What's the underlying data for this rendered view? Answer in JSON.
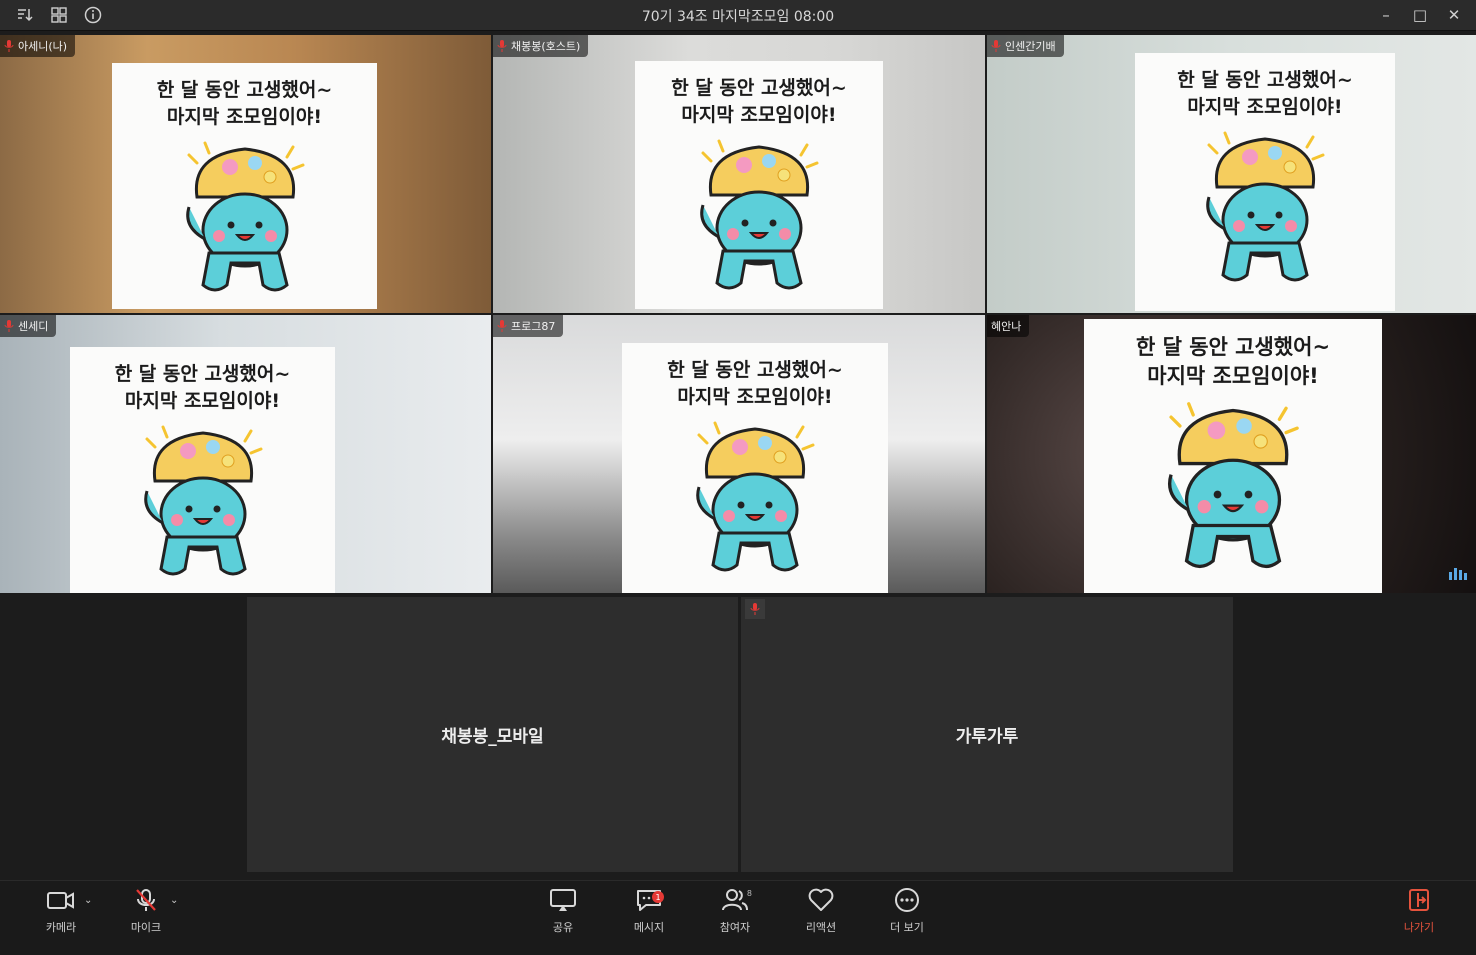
{
  "window": {
    "title": "70기 34조 마지막조모임 08:00",
    "controls": {
      "minimize": "–",
      "maximize": "□",
      "close": "✕"
    },
    "left_icons": [
      "sort-icon",
      "gallery-grid-icon",
      "info-icon"
    ]
  },
  "card": {
    "line1": "한 달 동안 고생했어~",
    "line2": "마지막 조모임이야!"
  },
  "participants": [
    {
      "name": "아세니(나)",
      "mic": "muted"
    },
    {
      "name": "채봉봉(호스트)",
      "mic": "muted"
    },
    {
      "name": "인센간기배",
      "mic": "muted"
    },
    {
      "name": "센세디",
      "mic": "muted"
    },
    {
      "name": "프로그87",
      "mic": "muted"
    },
    {
      "name": "혜안나",
      "mic": "speaking",
      "active_speaker": true
    }
  ],
  "audio_only": [
    {
      "name": "채봉봉_모바일"
    },
    {
      "name": "가투가투",
      "mic": "muted"
    }
  ],
  "toolbar": {
    "camera": "카메라",
    "mic": "마이크",
    "share": "공유",
    "message": "메시지",
    "message_badge": "1",
    "participants": "참여자",
    "participants_count": "8",
    "reaction": "리액션",
    "more": "더 보기",
    "leave": "나가기"
  },
  "colors": {
    "active_speaker": "#2ecc40",
    "leave": "#e5533d",
    "character_body": "#5ccfd9",
    "character_hat": "#f5cd5e"
  }
}
